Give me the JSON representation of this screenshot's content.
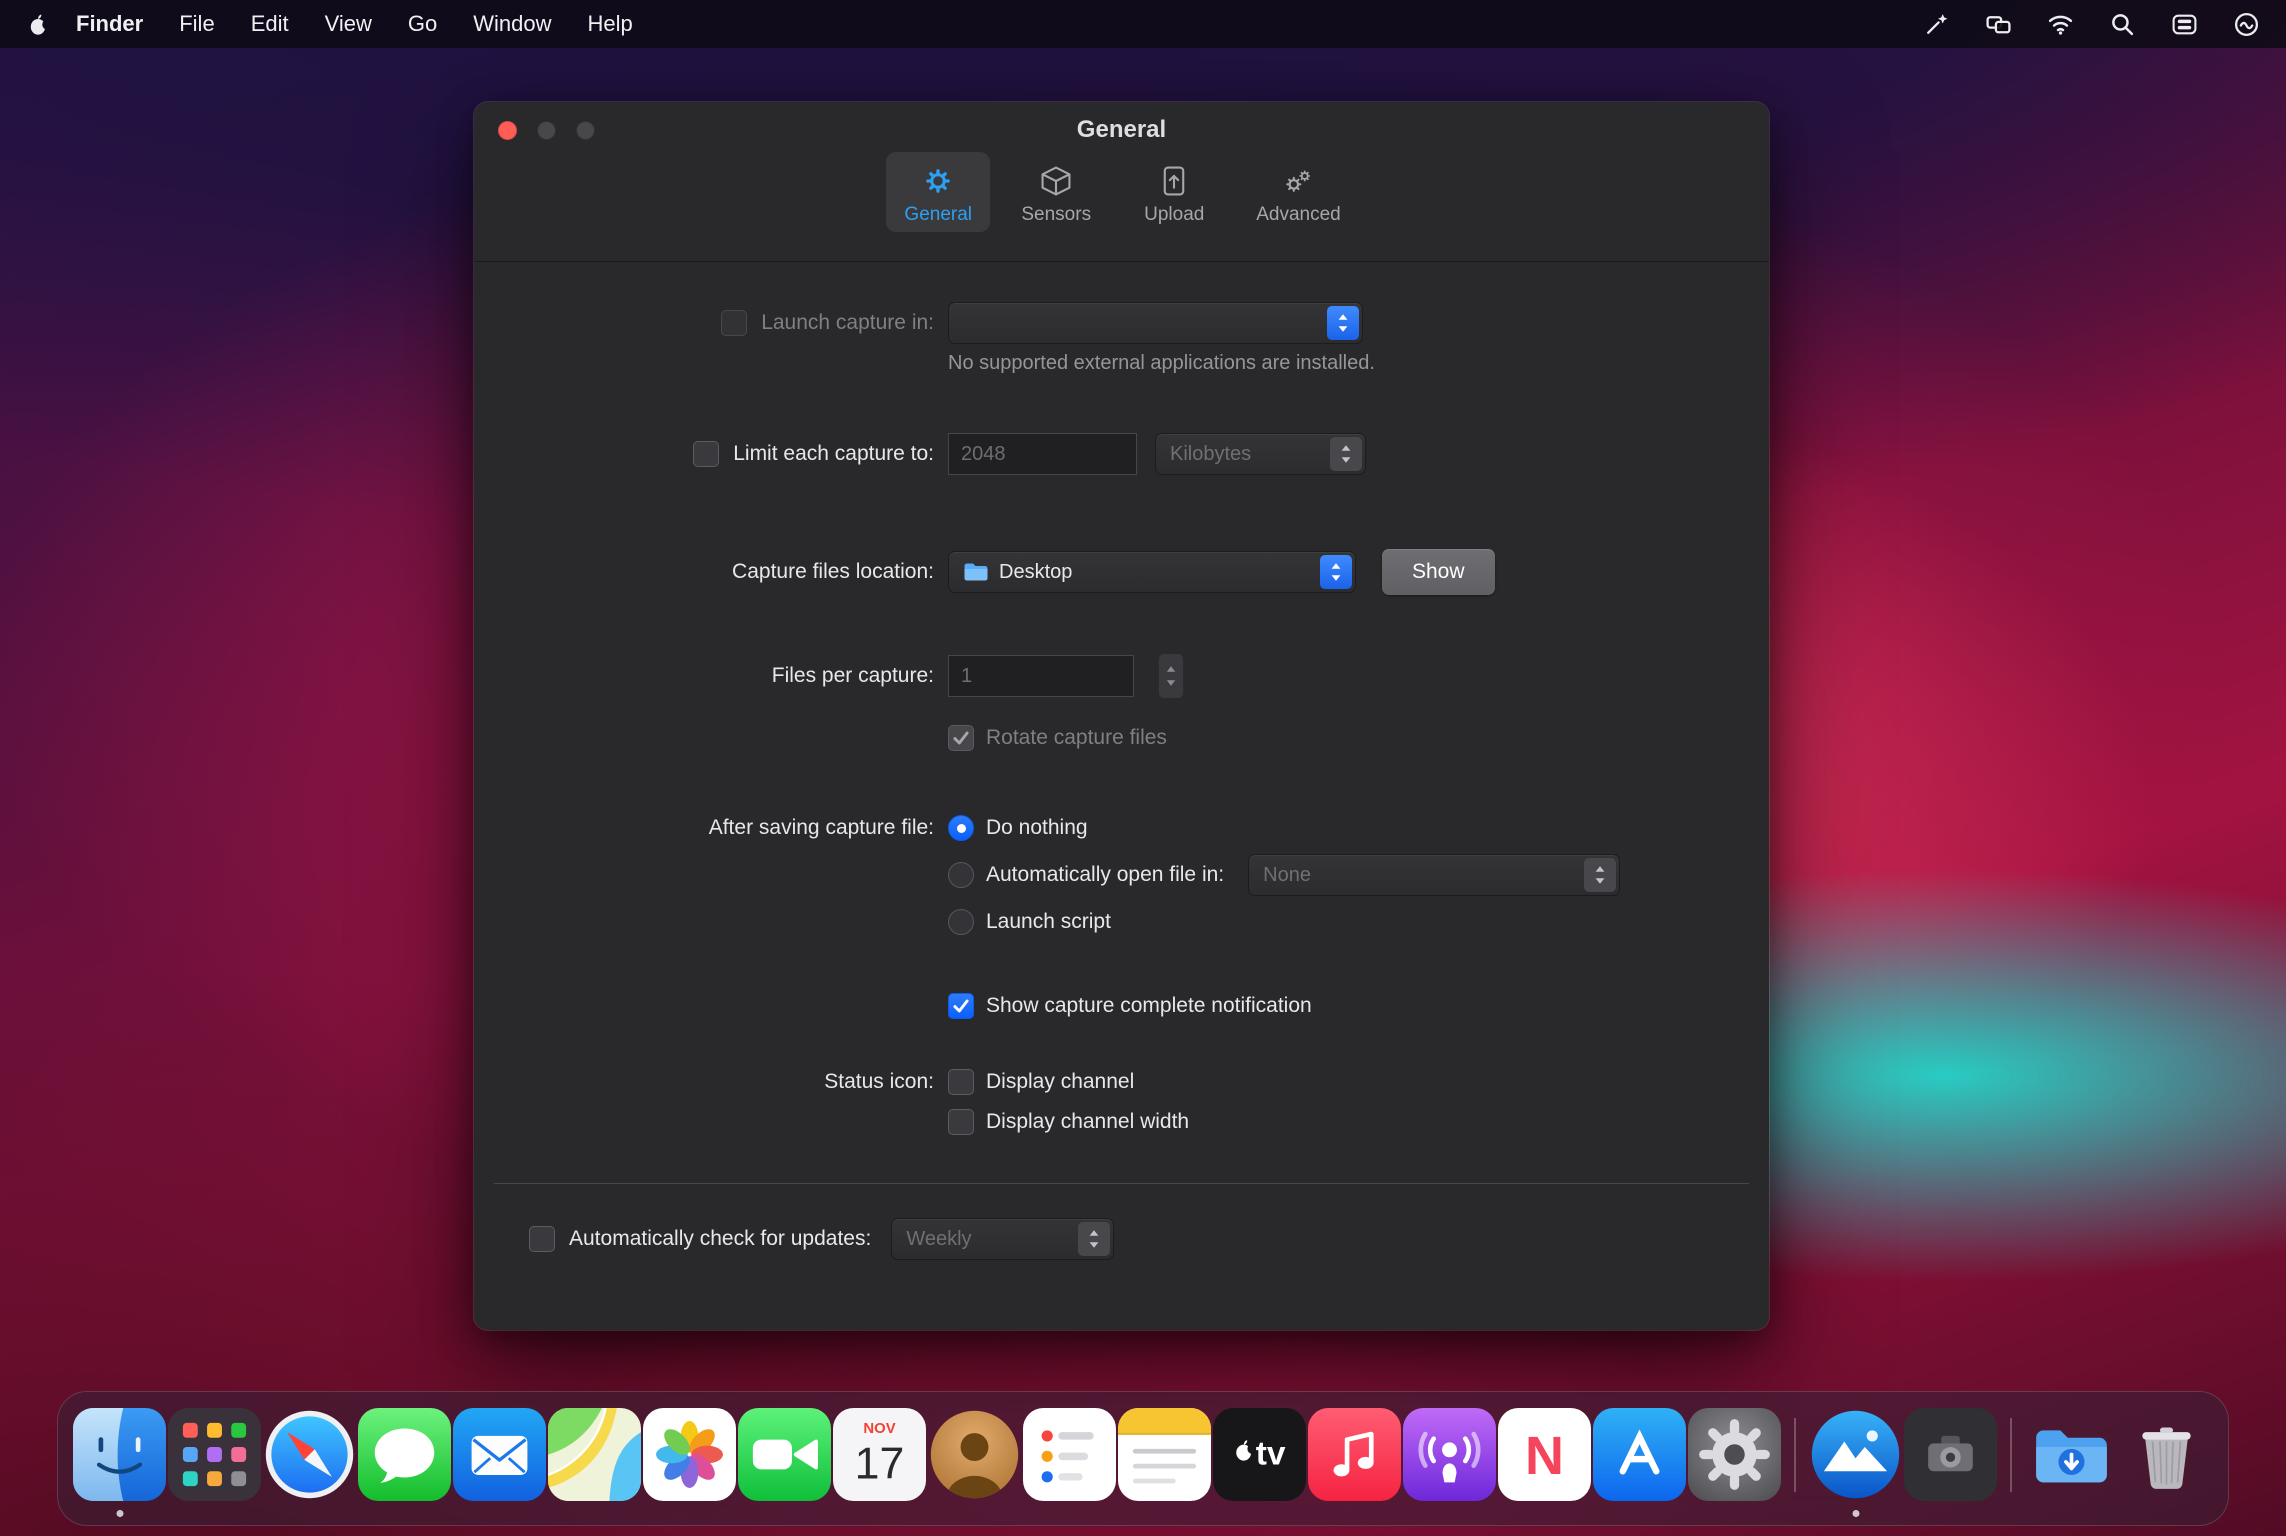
{
  "menu_bar": {
    "apple_logo": "apple",
    "items": [
      "Finder",
      "File",
      "Edit",
      "View",
      "Go",
      "Window",
      "Help"
    ],
    "status_icons": [
      "wand",
      "displays",
      "wifi",
      "search",
      "control-center",
      "siri"
    ]
  },
  "window": {
    "title": "General",
    "tabs": [
      {
        "label": "General",
        "icon": "gear",
        "selected": true
      },
      {
        "label": "Sensors",
        "icon": "cube",
        "selected": false
      },
      {
        "label": "Upload",
        "icon": "upload-doc",
        "selected": false
      },
      {
        "label": "Advanced",
        "icon": "gears",
        "selected": false
      }
    ],
    "form": {
      "launch_capture": {
        "label": "Launch capture in:",
        "value": "",
        "note": "No supported external applications are installed."
      },
      "limit_capture": {
        "label": "Limit each capture to:",
        "value": "2048",
        "unit": "Kilobytes"
      },
      "location": {
        "label": "Capture files location:",
        "value": "Desktop",
        "show_button": "Show"
      },
      "files_per_capture": {
        "label": "Files per capture:",
        "value": "1"
      },
      "rotate_label": "Rotate capture files",
      "after_saving": {
        "label": "After saving capture file:",
        "options": [
          "Do nothing",
          "Automatically open file in:",
          "Launch script"
        ],
        "selected_index": 0,
        "open_in_value": "None"
      },
      "notification_label": "Show capture complete notification",
      "status_icon": {
        "label": "Status icon:",
        "options": [
          "Display channel",
          "Display channel width"
        ]
      },
      "updates": {
        "label": "Automatically check for updates:",
        "value": "Weekly"
      }
    }
  },
  "dock": {
    "apps": [
      "finder",
      "launchpad",
      "safari",
      "messages",
      "mail",
      "maps",
      "photos",
      "facetime",
      "calendar",
      "contacts",
      "reminders",
      "notes",
      "tv",
      "music",
      "podcasts",
      "news",
      "app-store",
      "system-preferences",
      "capture-app",
      "utility-app",
      "downloads",
      "trash"
    ],
    "running_apps": [
      "finder",
      "capture-app"
    ],
    "calendar": {
      "month": "NOV",
      "day": "17"
    },
    "tv_label": "tv",
    "news_letter": "N"
  },
  "colors": {
    "accent_blue": "#0a60ff",
    "tab_selected_blue": "#2da0f2",
    "window_bg": "#29292b",
    "close_red": "#ff5d56",
    "wallpaper_red": "#cd194e",
    "wallpaper_teal": "#22d6ca",
    "wallpaper_indigo": "#1d1240"
  }
}
